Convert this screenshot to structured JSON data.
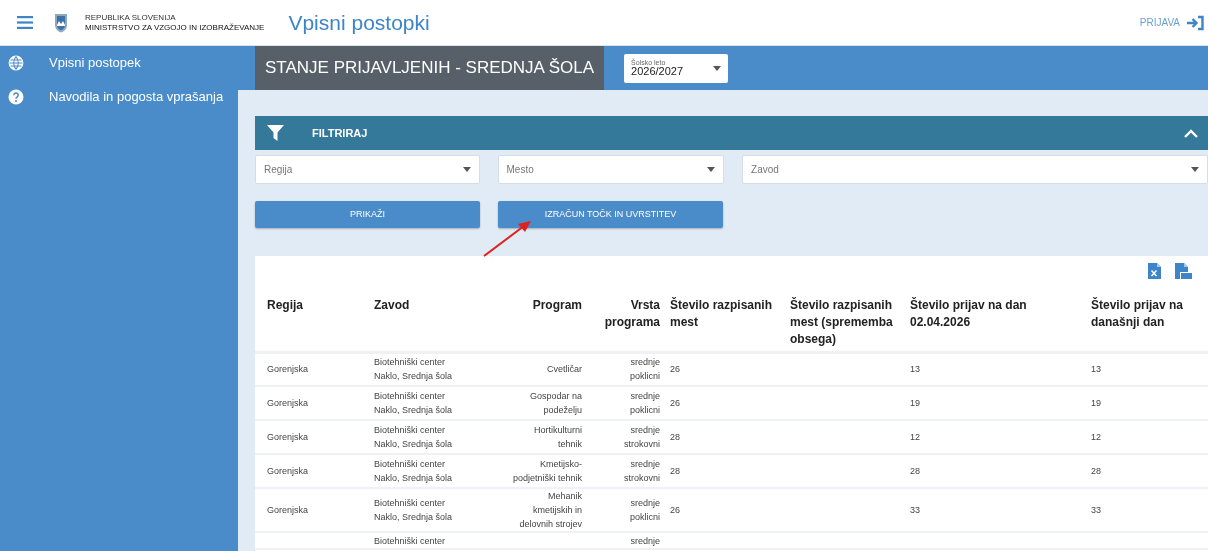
{
  "header": {
    "org_line_1": "REPUBLIKA SLOVENIJA",
    "org_line_2": "MINISTRSTVO ZA VZGOJO IN IZOBRAŽEVANJE",
    "app_title": "Vpisni postopki",
    "login": "PRIJAVA"
  },
  "sidebar": {
    "items": [
      {
        "label": "Vpisni postopek"
      },
      {
        "label": "Navodila in pogosta vprašanja"
      }
    ]
  },
  "page_title": "STANJE PRIJAVLJENIH - SREDNJA ŠOLA",
  "school_year": {
    "label": "Šolsko leto",
    "value": "2026/2027"
  },
  "filter": {
    "title": "FILTRIRAJ",
    "expanded": true,
    "dropdowns": [
      {
        "placeholder": "Regija"
      },
      {
        "placeholder": "Mesto"
      },
      {
        "placeholder": "Zavod"
      }
    ],
    "buttons": [
      "PRIKAŽI",
      "IZRAČUN TOČK IN UVRSTITEV"
    ]
  },
  "table": {
    "columns": [
      "Regija",
      "Zavod",
      "Program",
      "Vrsta programa",
      "Število razpisanih mest",
      "Število razpisanih mest (sprememba obsega)",
      "Število prijav na dan 02.04.2026",
      "Število prijav na današnji dan"
    ],
    "rows": [
      {
        "regija": "Gorenjska",
        "zavod": "Biotehniški center Naklo, Srednja šola",
        "program": "Cvetličar",
        "vrsta": "srednje poklicni",
        "razpisana_mesta": "26",
        "prijave_na_dan": "13",
        "prijave_danes": "13"
      },
      {
        "regija": "Gorenjska",
        "zavod": "Biotehniški center Naklo, Srednja šola",
        "program": "Gospodar na podeželju",
        "vrsta": "srednje poklicni",
        "razpisana_mesta": "26",
        "prijave_na_dan": "19",
        "prijave_danes": "19"
      },
      {
        "regija": "Gorenjska",
        "zavod": "Biotehniški center Naklo, Srednja šola",
        "program": "Hortikulturni tehnik",
        "vrsta": "srednje strokovni",
        "razpisana_mesta": "28",
        "prijave_na_dan": "12",
        "prijave_danes": "12"
      },
      {
        "regija": "Gorenjska",
        "zavod": "Biotehniški center Naklo, Srednja šola",
        "program": "Kmetijsko-podjetniški tehnik",
        "vrsta": "srednje strokovni",
        "razpisana_mesta": "28",
        "prijave_na_dan": "28",
        "prijave_danes": "28"
      },
      {
        "regija": "Gorenjska",
        "zavod": "Biotehniški center Naklo, Srednja šola",
        "program": "Mehanik kmetijskih in delovnih strojev",
        "vrsta": "srednje poklicni",
        "razpisana_mesta": "26",
        "prijave_na_dan": "33",
        "prijave_danes": "33"
      },
      {
        "zavod": "Biotehniški center",
        "vrsta": "srednje"
      }
    ]
  }
}
